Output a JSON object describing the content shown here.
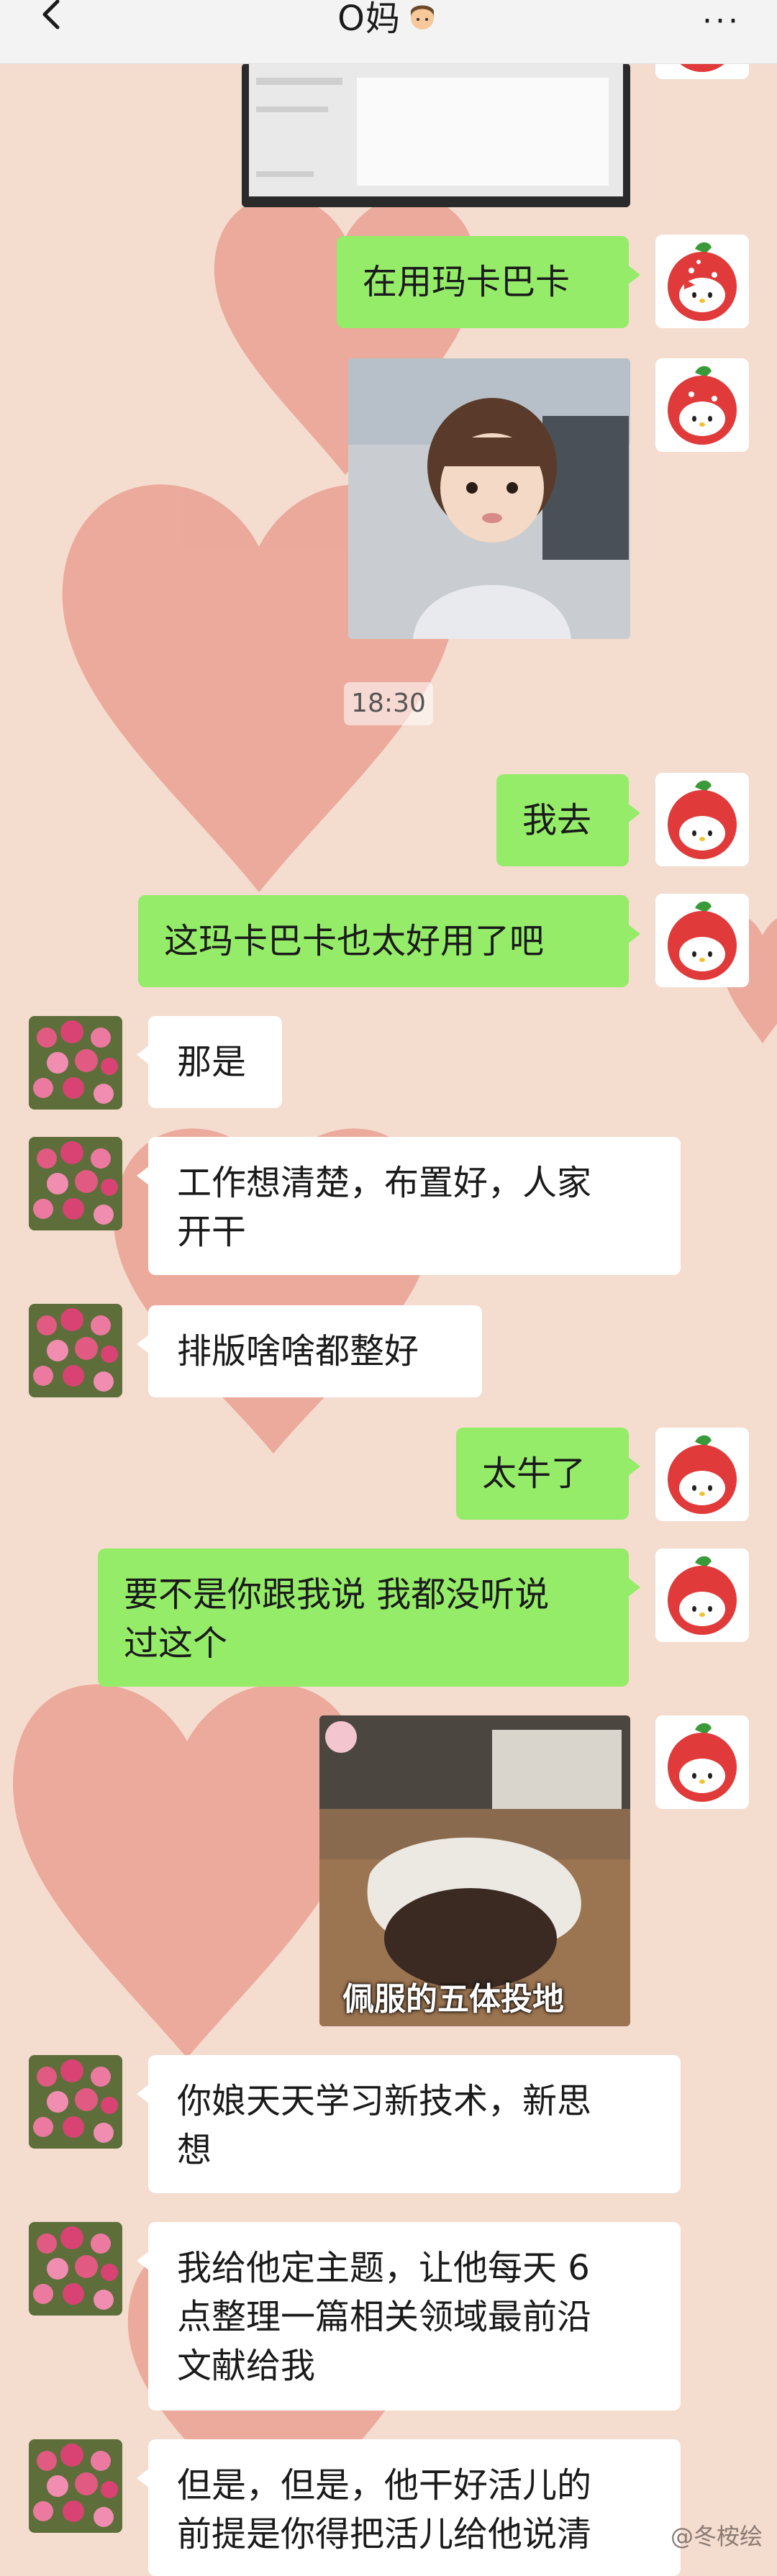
{
  "header": {
    "title": "O妈",
    "title_emoji": "woman-emoji",
    "back_icon": "chevron-left-icon",
    "more_icon": "more-dots-icon"
  },
  "colors": {
    "background": "#f4dccf",
    "heart": "#e89886",
    "green_bubble": "#95ec69",
    "white_bubble": "#ffffff"
  },
  "messages": {
    "m1": "在用玛卡巴卡",
    "time": "18:30",
    "m2": "我去",
    "m3": "这玛卡巴卡也太好用了吧",
    "m4": "那是",
    "m5_l1": "工作想清楚，布置好，人家",
    "m5_l2": "开干",
    "m6": "排版啥啥都整好",
    "m7": "太牛了",
    "m8_l1": "要不是你跟我说 我都没听说",
    "m8_l2": "过这个",
    "sticker_caption": "佩服的五体投地",
    "m9_l1": "你娘天天学习新技术，新思",
    "m9_l2": "想",
    "m10_l1": "我给他定主题，让他每天 6",
    "m10_l2": "点整理一篇相关领域最前沿",
    "m10_l3": "文献给我",
    "m11_l1": "但是，但是，他干好活儿的",
    "m11_l2": "前提是你得把活儿给他说清"
  },
  "watermark": "@冬桉绘"
}
